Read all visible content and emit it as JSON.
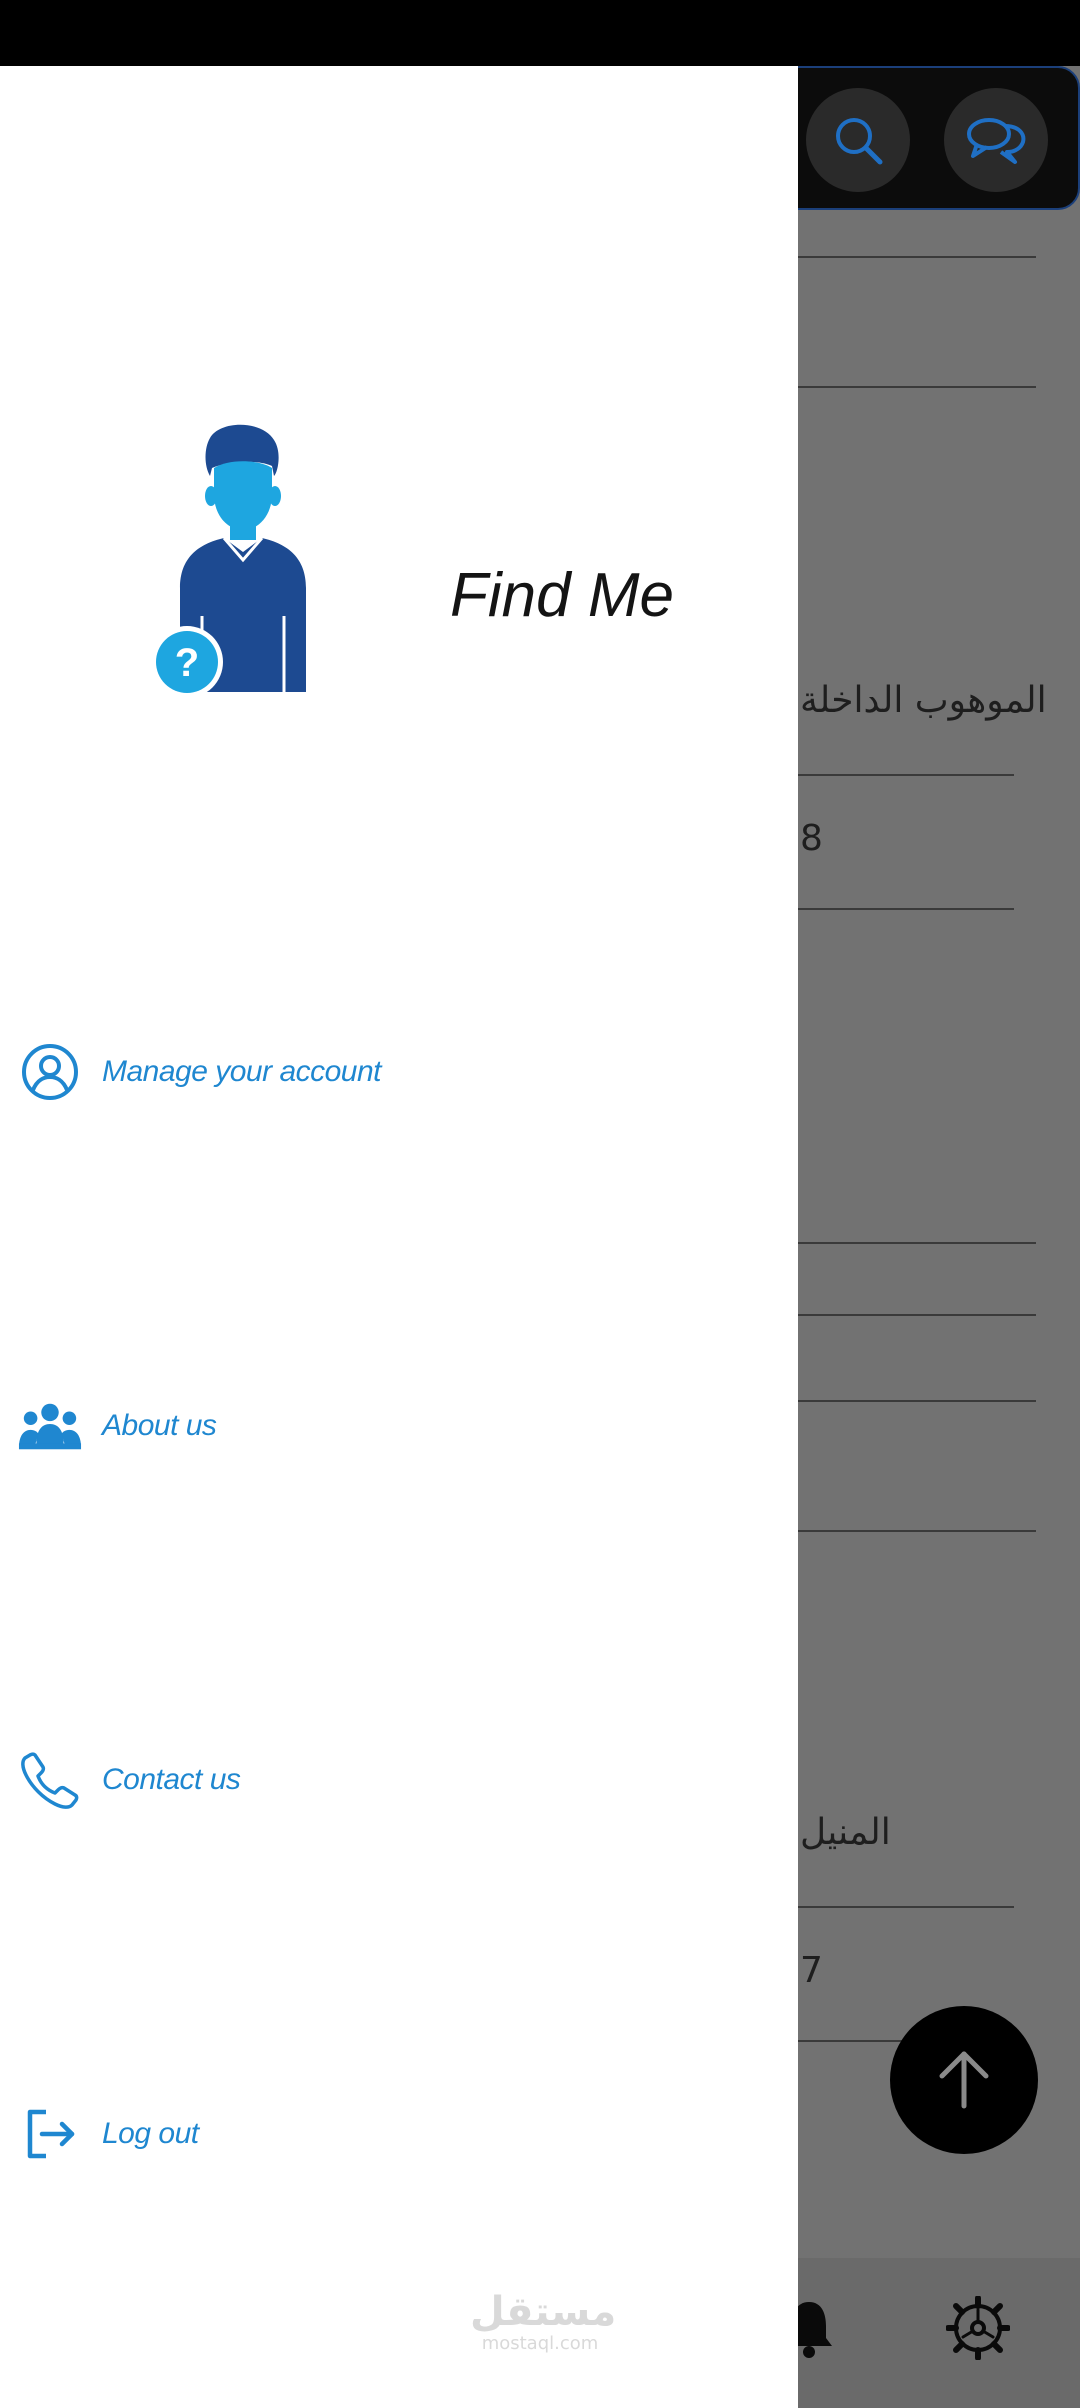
{
  "background": {
    "text_top": "الموهوب الداخلة",
    "number_top": "8",
    "text_bottom": "المنيل",
    "number_bottom": "7"
  },
  "drawer": {
    "title": "Find Me",
    "menu": [
      {
        "label": "Manage your account",
        "icon": "user-circle-icon"
      },
      {
        "label": "About us",
        "icon": "users-icon"
      },
      {
        "label": "Contact us",
        "icon": "phone-icon"
      },
      {
        "label": "Log out",
        "icon": "logout-icon"
      }
    ]
  },
  "watermark": {
    "arabic": "مستقل",
    "latin": "mostaql.com"
  },
  "colors": {
    "accent": "#1f87d0",
    "avatar_dark": "#1d4a91",
    "avatar_light": "#1ea6e0",
    "overlay_gray": "#727272"
  }
}
